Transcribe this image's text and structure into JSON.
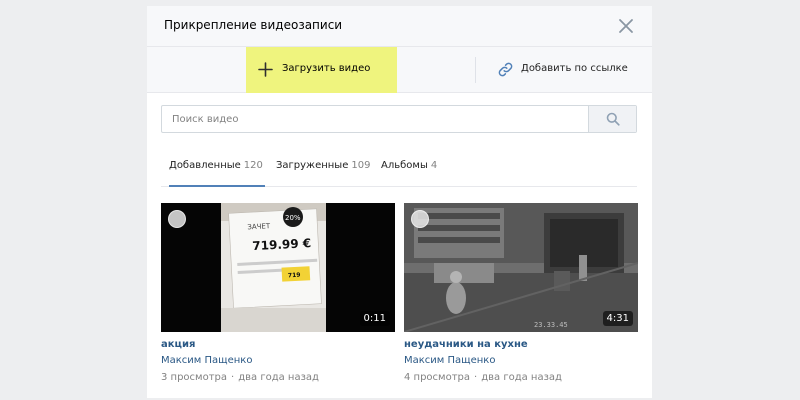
{
  "modal": {
    "title": "Прикрепление видеозаписи",
    "close_icon": "close-icon"
  },
  "toolbar": {
    "upload_label": "Загрузить видео",
    "upload_icon": "plus-icon",
    "upload_bg": "#eff47e",
    "link_label": "Добавить по ссылке",
    "link_icon": "link-icon"
  },
  "search": {
    "placeholder": "Поиск видео",
    "value": "",
    "icon": "search-icon"
  },
  "tabs": [
    {
      "label": "Добавленные",
      "count": "120",
      "active": true
    },
    {
      "label": "Загруженные",
      "count": "109",
      "active": false
    },
    {
      "label": "Альбомы",
      "count": "4",
      "active": false
    }
  ],
  "videos": [
    {
      "title": "акция",
      "author": "Максим Пащенко",
      "views": "3 просмотра",
      "dot": "·",
      "date": "два года назад",
      "duration": "0:11",
      "thumb_price": "719.99 €",
      "thumb_badge": "20%",
      "thumb_small": "719"
    },
    {
      "title": "неудачники на кухне",
      "author": "Максим Пащенко",
      "views": "4 просмотра",
      "dot": "·",
      "date": "два года назад",
      "duration": "4:31",
      "thumb_timestamp": "23.33.45"
    }
  ],
  "colors": {
    "accent": "#5181b8",
    "link": "#2a5885",
    "muted": "#828282"
  }
}
